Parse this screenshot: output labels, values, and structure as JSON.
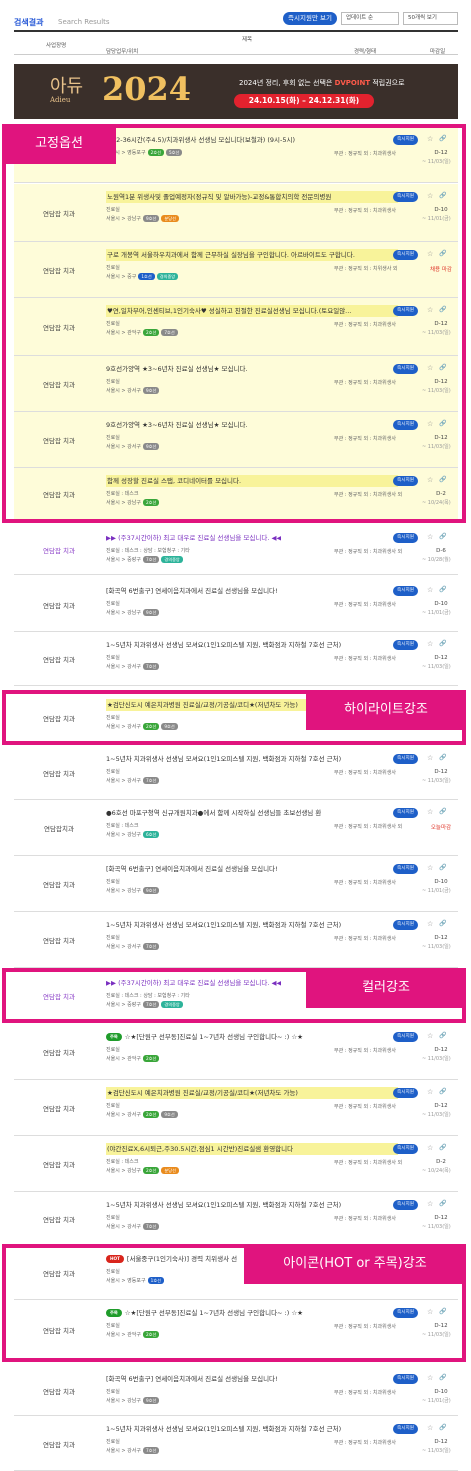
{
  "header": {
    "title": "검색결과",
    "subtitle": "Search Results",
    "urgent_btn": "즉시지원만 보기",
    "sort": "업데이트 순",
    "perpage": "50개씩 보기"
  },
  "columns": {
    "company": "사업장명",
    "title": "제목",
    "dept": "담당업무/위치",
    "career": "경력/형태",
    "deadline": "마감일"
  },
  "banner": {
    "logo": "아듀",
    "logo_en": "Adieu",
    "year": "2024",
    "line1_a": "2024년 정리, 후회 없는 선택은 ",
    "line1_b": "DVPOINT",
    "line1_c": " 적립권으로",
    "dates": "24.10.15(화) – 24.12.31(화)"
  },
  "labels": {
    "fixed": "고정옵션",
    "highlight": "하이라이트강조",
    "color": "컬러강조",
    "icon": "아이콘(HOT or 주목)강조"
  },
  "common": {
    "urgent": "즉시지원",
    "star": "☆",
    "link": "🔗"
  },
  "rows": [
    {
      "company": "",
      "title": "주32-36시간(주4.5)/치과위생사 선생님 모십니다(보철과) (9시-5시)",
      "role": "",
      "loc": "서울시 > 영등포구",
      "tags": [
        "2호선",
        "5호선"
      ],
      "cond": "무관 : 정규직 외 : 치과위생사",
      "dl": "D-12",
      "date": "~ 11/03(일)"
    },
    {
      "company": "연담잡 치과",
      "title": "노원역1분 위생사및 졸업예정자(정규직 및 알바가능)-교정&통합치의학 전문의병원",
      "role": "진료실",
      "loc": "서울시 > 강남구",
      "tags": [
        "9호선",
        "분당선"
      ],
      "cond": "무관 : 정규직 외 : 치과위생사",
      "dl": "D-10",
      "date": "~ 11/01(금)"
    },
    {
      "company": "연담잡 치과",
      "title": "구로 개봉역 서울하우치과에서 함께 근무하실 실장님을 구인합니다. 아르바이트도 구합니다.",
      "role": "진료실",
      "loc": "서울시 > 중구",
      "tags": [
        "1호선",
        "경의중앙"
      ],
      "cond": "무관 : 정규직 외 : 치위생사 외",
      "dl": "채용 마감",
      "date": ""
    },
    {
      "company": "연담잡 치과",
      "title": "♥연,일차부어,인센티브,1인기숙사♥ 성실하고 친절한 진료실선생님 모십니다.(토요일않...",
      "role": "진료실",
      "loc": "서울시 > 관악구",
      "tags": [
        "2호선",
        "7호선"
      ],
      "cond": "무관 : 정규직 외 : 치과위생사",
      "dl": "D-12",
      "date": "~ 11/03(일)"
    },
    {
      "company": "연담잡 치과",
      "title": "9호선가양역 ★3~6년차 진료실 선생님★ 모십니다.",
      "role": "진료실",
      "loc": "서울시 > 강서구",
      "tags": [
        "9호선"
      ],
      "cond": "무관 : 정규직 외 : 치과위생사",
      "dl": "D-12",
      "date": "~ 11/03(일)"
    },
    {
      "company": "연담잡 치과",
      "title": "9호선가양역 ★3~6년차 진료실 선생님★ 모십니다.",
      "role": "진료실",
      "loc": "서울시 > 강서구",
      "tags": [
        "9호선"
      ],
      "cond": "무관 : 정규직 외 : 치과위생사",
      "dl": "D-12",
      "date": "~ 11/03(일)"
    },
    {
      "company": "연담잡 치과",
      "title": "함께 성장할 진료실 스탭, 코디네이터를 모십니다.",
      "role": "진료실 : 데스크",
      "loc": "서울시 > 강남구",
      "tags": [
        "2호선"
      ],
      "cond": "무관 : 정규직 외 : 치과위생사 외",
      "dl": "D-2",
      "date": "~ 10/24(목)"
    },
    {
      "company": "연담잡 치과",
      "title": "▶▶ (주37시간이하) 최고 대우로 진료실 선생님을 모십니다. ◀◀",
      "role": "진료실 : 데스크 : 상담 : 보험청구 : 기타",
      "loc": "서울시 > 중랑구",
      "tags": [
        "7호선",
        "경의중앙"
      ],
      "cond": "무관 : 정규직 외 : 치과위생사 외",
      "dl": "D-6",
      "date": "~ 10/28(월)"
    },
    {
      "company": "연담잡 치과",
      "title": "[화곡역 6번출구] 연세이음치과에서 진료실 선생님을 모십니다!",
      "role": "진료실",
      "loc": "서울시 > 강남구",
      "tags": [
        "9호선"
      ],
      "cond": "무관 : 정규직 외 : 치과위생사",
      "dl": "D-10",
      "date": "~ 11/01(금)"
    },
    {
      "company": "연담잡 치과",
      "title": "1~5년차 치과위생사 선생님 모셔요(1인1오피스텔 지원, 백화점과 지하철 7호선 근처)",
      "role": "진료실",
      "loc": "서울시 > 강서구",
      "tags": [
        "7호선"
      ],
      "cond": "무관 : 정규직 외 : 치과위생사",
      "dl": "D-12",
      "date": "~ 11/03(일)"
    },
    {
      "company": "연담잡 치과",
      "title": "★검단신도시 예은치과병원 진료실/교정/기공실/코디★(저년차도 가능)",
      "role": "진료실",
      "loc": "서울시 > 강서구",
      "tags": [
        "2호선",
        "9호선"
      ],
      "cond": "",
      "dl": "",
      "date": "~ 11/03(일)"
    },
    {
      "company": "연담잡 치과",
      "title": "1~5년차 치과위생사 선생님 모셔요(1인1오피스텔 지원, 백화점과 지하철 7호선 근처)",
      "role": "진료실",
      "loc": "서울시 > 강서구",
      "tags": [
        "7호선"
      ],
      "cond": "무관 : 정규직 외 : 치과위생사",
      "dl": "D-12",
      "date": "~ 11/03(일)"
    },
    {
      "company": "연담잡치과",
      "title": "●6호선 마포구청역 신규개원치과●에서 함께 시작하실 선생님들 초보선생님 환",
      "role": "진료실 : 데스크",
      "loc": "서울시 > 강남구",
      "tags": [
        "6호선"
      ],
      "cond": "무관 : 정규직 외 : 치과위생사 외",
      "dl": "오늘마감",
      "date": ""
    },
    {
      "company": "연담잡 치과",
      "title": "[화곡역 6번출구] 연세이음치과에서 진료실 선생님을 모십니다!",
      "role": "진료실",
      "loc": "서울시 > 강남구",
      "tags": [
        "9호선"
      ],
      "cond": "무관 : 정규직 외 : 치과위생사",
      "dl": "D-10",
      "date": "~ 11/01(금)"
    },
    {
      "company": "연담잡 치과",
      "title": "1~5년차 치과위생사 선생님 모셔요(1인1오피스텔 지원, 백화점과 지하철 7호선 근처)",
      "role": "진료실",
      "loc": "서울시 > 강서구",
      "tags": [
        "7호선"
      ],
      "cond": "무관 : 정규직 외 : 치과위생사",
      "dl": "D-12",
      "date": "~ 11/03(일)"
    },
    {
      "company": "연담잡 치과",
      "title": "▶▶ (주37시간이하) 최고 대우로 진료실 선생님을 모십니다. ◀◀",
      "role": "진료실 : 데스크 : 상담 : 보험청구 : 기타",
      "loc": "서울시 > 중랑구",
      "tags": [
        "7호선",
        "경의중앙"
      ],
      "cond": "",
      "dl": "",
      "date": "~ 10/28(월)"
    },
    {
      "company": "연담잡 치과",
      "badge": "주목",
      "title": "☆★[단원구 선부동]진료실 1~7년차 선생님 구인합니다~ :) ☆★",
      "role": "진료실",
      "loc": "서울시 > 관악구",
      "tags": [
        "2호선"
      ],
      "cond": "무관 : 정규직 외 : 치과위생사",
      "dl": "D-12",
      "date": "~ 11/03(일)"
    },
    {
      "company": "연담잡 치과",
      "title": "★검단신도시 예은치과병원 진료실/교정/기공실/코디★(저년차도 가능)",
      "role": "진료실",
      "loc": "서울시 > 강서구",
      "tags": [
        "2호선",
        "9호선"
      ],
      "cond": "무관 : 정규직 외 : 치과위생사",
      "dl": "D-12",
      "date": "~ 11/03(일)"
    },
    {
      "company": "연담잡 치과",
      "title": "(야간진료X,6시퇴근,주30.5시간,점심1 시간반)진료실샘 환영합니다",
      "role": "진료실 : 데스크",
      "loc": "서울시 > 강남구",
      "tags": [
        "2호선",
        "분당선"
      ],
      "cond": "무관 : 정규직 외 : 치과위생사 외",
      "dl": "D-2",
      "date": "~ 10/24(목)"
    },
    {
      "company": "연담잡 치과",
      "title": "1~5년차 치과위생사 선생님 모셔요(1인1오피스텔 지원, 백화점과 지하철 7호선 근처)",
      "role": "진료실",
      "loc": "서울시 > 강서구",
      "tags": [
        "7호선"
      ],
      "cond": "무관 : 정규직 외 : 치과위생사",
      "dl": "D-12",
      "date": "~ 11/03(일)"
    },
    {
      "company": "연담잡 치과",
      "badge": "HOT",
      "title": "[서울중구(1인기숙사)] 경력 치위생사 선",
      "role": "진료실",
      "loc": "서울시 > 영등포구",
      "tags": [
        "1호선"
      ],
      "cond": "",
      "dl": "",
      "date": ""
    },
    {
      "company": "연담잡 치과",
      "badge": "주목",
      "title": "☆★[단원구 선부동]진료실 1~7년차 선생님 구인합니다~ :) ☆★",
      "role": "진료실",
      "loc": "서울시 > 관악구",
      "tags": [
        "2호선"
      ],
      "cond": "무관 : 정규직 외 : 치과위생사",
      "dl": "D-12",
      "date": "~ 11/03(일)"
    },
    {
      "company": "연담잡 치과",
      "title": "[화곡역 6번출구] 연세이음치과에서 진료실 선생님을 모십니다!",
      "role": "진료실",
      "loc": "서울시 > 강남구",
      "tags": [
        "9호선"
      ],
      "cond": "무관 : 정규직 외 : 치과위생사",
      "dl": "D-10",
      "date": "~ 11/01(금)"
    },
    {
      "company": "연담잡 치과",
      "title": "1~5년차 치과위생사 선생님 모셔요(1인1오피스텔 지원, 백화점과 지하철 7호선 근처)",
      "role": "진료실",
      "loc": "서울시 > 강서구",
      "tags": [
        "7호선"
      ],
      "cond": "무관 : 정규직 외 : 치과위생사",
      "dl": "D-12",
      "date": "~ 11/03(일)"
    }
  ]
}
